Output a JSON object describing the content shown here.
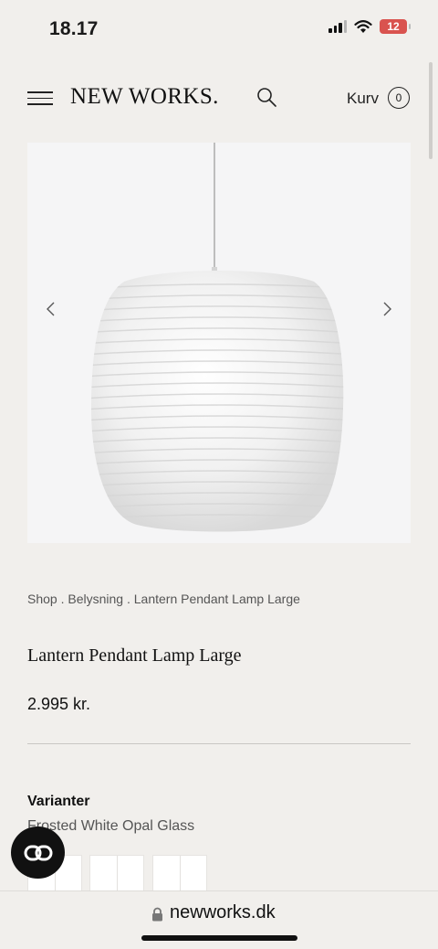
{
  "status_bar": {
    "time": "18.17",
    "battery": "12"
  },
  "header": {
    "logo": "NEW WORKS.",
    "cart_label": "Kurv",
    "cart_count": "0"
  },
  "breadcrumb": {
    "items": [
      "Shop",
      "Belysning",
      "Lantern Pendant Lamp Large"
    ],
    "separator": " . "
  },
  "product": {
    "title": "Lantern Pendant Lamp Large",
    "price": "2.995 kr.",
    "variants_label": "Varianter",
    "selected_variant": "Frosted White Opal Glass"
  },
  "browser": {
    "url": "newworks.dk"
  },
  "icons": [
    "menu-icon",
    "search-icon",
    "arrow-left-icon",
    "arrow-right-icon",
    "chat-icon",
    "lock-icon",
    "wifi-icon",
    "signal-icon"
  ],
  "colors": {
    "background": "#f1efec",
    "battery_low": "#d9534f",
    "text": "#1a1a1a"
  }
}
